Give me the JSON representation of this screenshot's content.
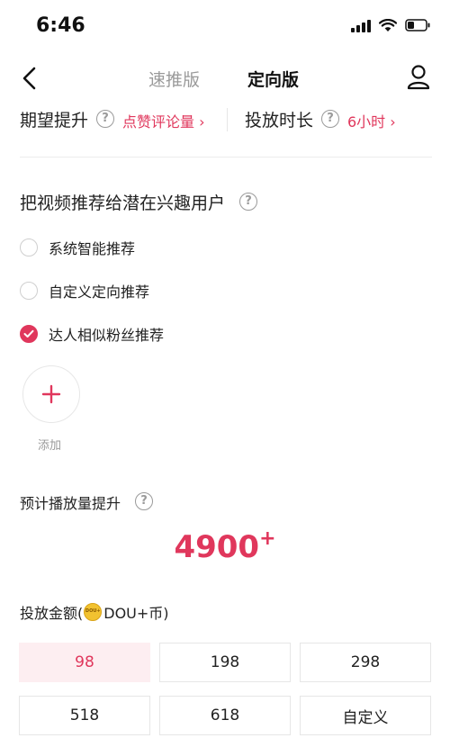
{
  "status_bar": {
    "time": "6:46"
  },
  "nav": {
    "tabs": [
      {
        "label": "速推版",
        "active": false
      },
      {
        "label": "定向版",
        "active": true
      }
    ]
  },
  "expectation": {
    "boost_label": "期望提升",
    "boost_value": "点赞评论量 ›",
    "duration_label": "投放时长",
    "duration_value": "6小时 ›"
  },
  "audience": {
    "title": "把视频推荐给潜在兴趣用户",
    "options": [
      {
        "label": "系统智能推荐",
        "checked": false
      },
      {
        "label": "自定义定向推荐",
        "checked": false
      },
      {
        "label": "达人相似粉丝推荐",
        "checked": true
      }
    ],
    "add_label": "添加"
  },
  "forecast": {
    "title": "预计播放量提升",
    "value": "4900",
    "suffix": "+"
  },
  "amount": {
    "title_prefix": "投放金额(",
    "coin_text": "DOU+",
    "title_suffix": "DOU+币)",
    "options": [
      {
        "label": "98",
        "selected": true
      },
      {
        "label": "198",
        "selected": false
      },
      {
        "label": "298",
        "selected": false
      },
      {
        "label": "518",
        "selected": false
      },
      {
        "label": "618",
        "selected": false
      },
      {
        "label": "自定义",
        "selected": false
      }
    ]
  },
  "colors": {
    "accent": "#e0375c",
    "selected_bg": "#fdeef1",
    "muted": "#9a9a9a"
  }
}
